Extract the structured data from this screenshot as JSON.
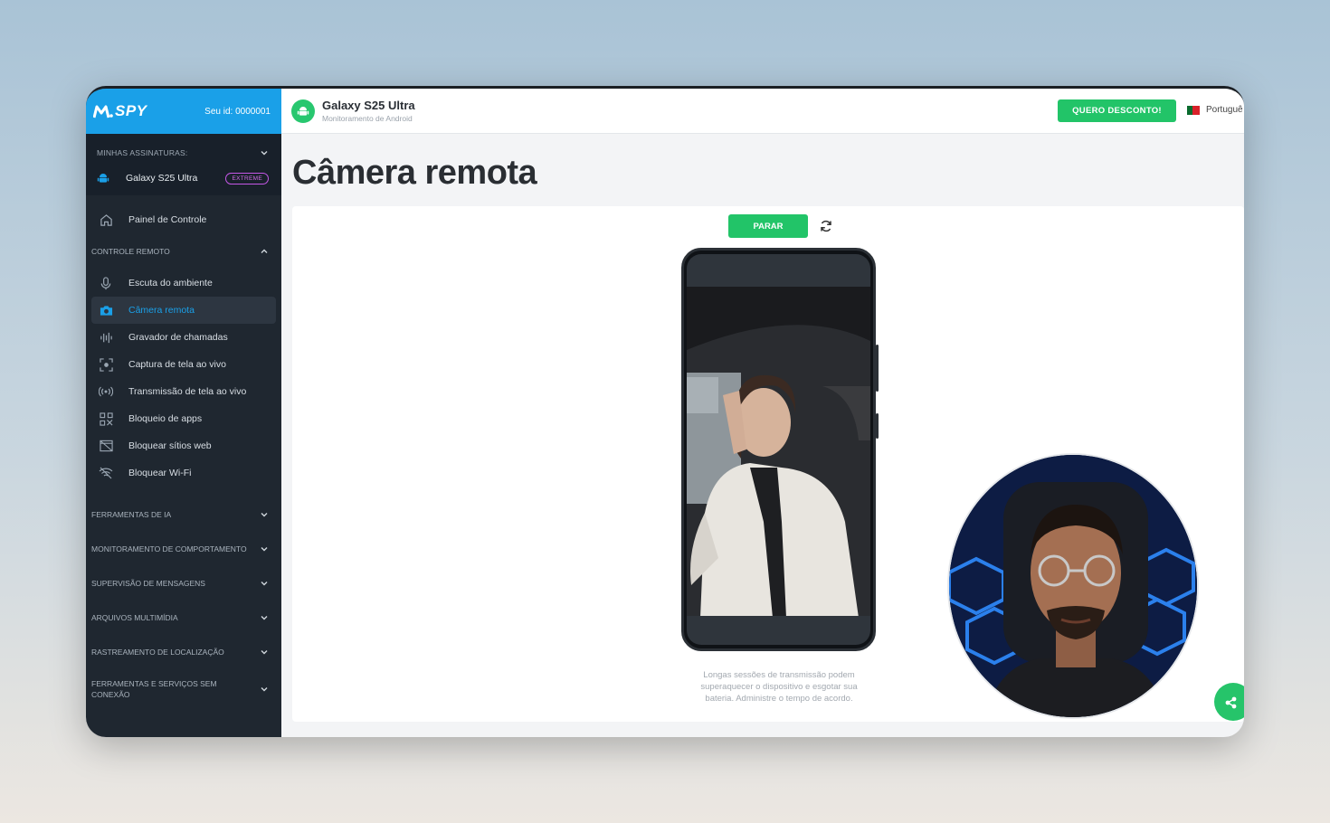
{
  "sidebar": {
    "logo": "SPY",
    "user_id": "Seu id: 0000001",
    "subscriptions_heading": "MINHAS ASSINATURAS:",
    "device_name": "Galaxy S25 Ultra",
    "plan_badge": "EXTREME",
    "dashboard": "Painel de Controle",
    "remote_control_heading": "CONTROLE REMOTO",
    "items": [
      {
        "label": "Escuta do ambiente",
        "icon": "microphone-icon"
      },
      {
        "label": "Câmera remota",
        "icon": "camera-icon",
        "active": true
      },
      {
        "label": "Gravador de chamadas",
        "icon": "waveform-icon"
      },
      {
        "label": "Captura de tela ao vivo",
        "icon": "screen-capture-icon"
      },
      {
        "label": "Transmissão de tela ao vivo",
        "icon": "broadcast-icon"
      },
      {
        "label": "Bloqueio de apps",
        "icon": "app-block-icon"
      },
      {
        "label": "Bloquear sítios web",
        "icon": "web-block-icon"
      },
      {
        "label": "Bloquear Wi-Fi",
        "icon": "wifi-off-icon"
      }
    ],
    "categories": [
      "FERRAMENTAS DE IA",
      "MONITORAMENTO DE COMPORTAMENTO",
      "SUPERVISÃO DE MENSAGENS",
      "ARQUIVOS MULTIMÍDIA",
      "RASTREAMENTO DE LOCALIZAÇÃO",
      "FERRAMENTAS E SERVIÇOS SEM CONEXÃO"
    ]
  },
  "topbar": {
    "device_name": "Galaxy S25 Ultra",
    "device_subtitle": "Monitoramento de Android",
    "promo_button": "QUERO DESCONTO!",
    "language": "Portuguê"
  },
  "main": {
    "title": "Câmera remota",
    "stop_button": "PARAR",
    "note": "Longas sessões de transmissão podem superaquecer o dispositivo e esgotar sua bateria. Administre o tempo de acordo."
  },
  "colors": {
    "brand_blue": "#1aa0e8",
    "sidebar_bg": "#1f2730",
    "accent_green": "#22c468",
    "badge_purple": "#c457e6"
  }
}
